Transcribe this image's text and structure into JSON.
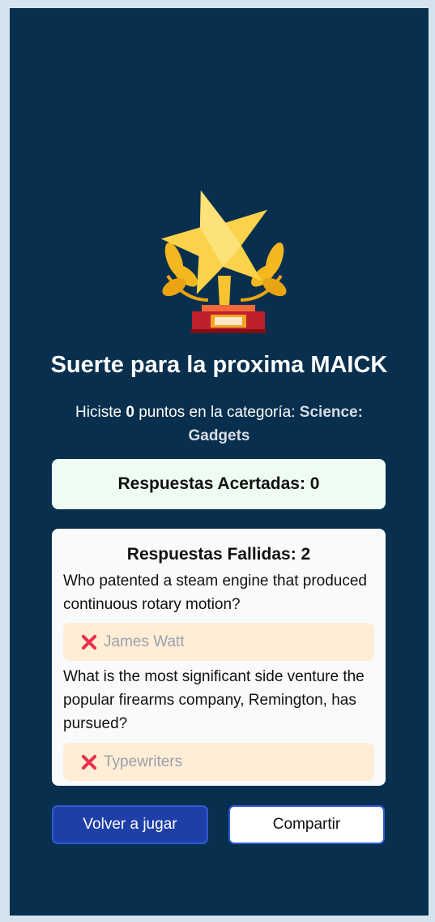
{
  "result": {
    "title": "Suerte para la proxima MAICK",
    "subtitle_prefix": "Hiciste",
    "points": "0",
    "subtitle_middle": "puntos en la categoría:",
    "category": "Science: Gadgets"
  },
  "correct": {
    "label": "Respuestas Acertadas: 0"
  },
  "wrong": {
    "label": "Respuestas Fallidas: 2",
    "items": [
      {
        "question": "Who patented a steam engine that produced continuous rotary motion?",
        "answer": "James Watt"
      },
      {
        "question": "What is the most significant side venture the popular firearms company, Remington, has pursued?",
        "answer": "Typewriters"
      }
    ]
  },
  "buttons": {
    "replay": "Volver a jugar",
    "share": "Compartir"
  },
  "icons": {
    "trophy": "trophy-icon",
    "wrong": "x-mark-icon"
  },
  "colors": {
    "background": "#082f4d",
    "primary_button": "#1f3fa8",
    "error": "#e8304f"
  }
}
